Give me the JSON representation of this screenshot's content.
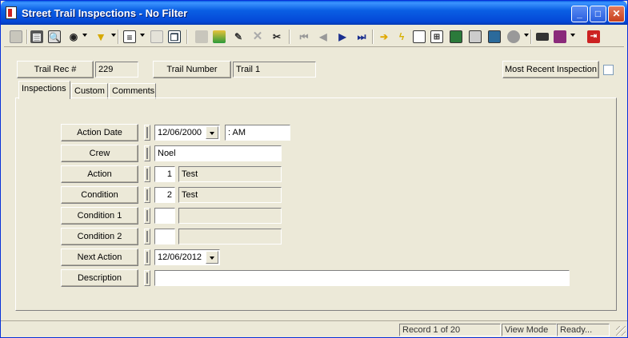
{
  "window": {
    "title": "Street Trail Inspections - No Filter",
    "minimize": "_",
    "maximize": "□",
    "close": "✕"
  },
  "toolbar": {
    "icons": [
      "new-record-icon",
      "print-icon",
      "print-preview-icon",
      "binoculars-search-icon",
      "filter-icon",
      "sort-icon",
      "copy-record-icon",
      "paste-record-icon",
      "save-icon",
      "spellcheck-icon",
      "edit-pencil-icon",
      "delete-x-icon",
      "cut-scissors-icon",
      "first-record-icon",
      "previous-record-icon",
      "next-record-icon",
      "last-record-icon",
      "go-to-record-icon",
      "lightning-icon",
      "report-icon",
      "tree-icon",
      "map-icon",
      "calculator-icon",
      "chart-icon",
      "globe-icon",
      "keyboard-icon",
      "book-icon",
      "exit-icon"
    ]
  },
  "header": {
    "trail_rec_label": "Trail Rec #",
    "trail_rec_value": "229",
    "trail_number_label": "Trail Number",
    "trail_number_value": "Trail 1",
    "most_recent_label": "Most Recent Inspection"
  },
  "tabs": [
    {
      "label": "Inspections"
    },
    {
      "label": "Custom"
    },
    {
      "label": "Comments"
    }
  ],
  "form": {
    "action_date": {
      "label": "Action Date",
      "date": "12/06/2000",
      "time": " :  AM"
    },
    "crew": {
      "label": "Crew",
      "value": "Noel"
    },
    "action": {
      "label": "Action",
      "code": "1",
      "desc": "Test"
    },
    "condition": {
      "label": "Condition",
      "code": "2",
      "desc": "Test"
    },
    "condition1": {
      "label": "Condition 1",
      "code": "",
      "desc": ""
    },
    "condition2": {
      "label": "Condition 2",
      "code": "",
      "desc": ""
    },
    "next_action": {
      "label": "Next Action",
      "date": "12/06/2012"
    },
    "description": {
      "label": "Description",
      "value": ""
    }
  },
  "status": {
    "record": "Record 1 of 20",
    "mode": "View Mode",
    "state": "Ready..."
  }
}
